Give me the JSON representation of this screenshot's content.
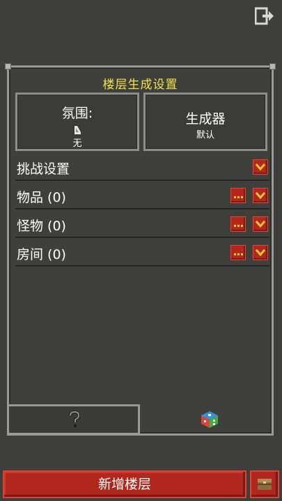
{
  "panel": {
    "title": "楼层生成设置",
    "atmosphere": {
      "title": "氛围:",
      "value": "无"
    },
    "generator": {
      "title": "生成器",
      "value": "默认"
    },
    "rows": [
      {
        "label": "挑战设置"
      },
      {
        "label": "物品 (0)"
      },
      {
        "label": "怪物 (0)"
      },
      {
        "label": "房间 (0)"
      }
    ]
  },
  "bottom": {
    "add_floor_label": "新增楼层"
  },
  "colors": {
    "accent_title": "#f3e24a",
    "button_red": "#b0281d",
    "frame": "#9a9a96"
  }
}
